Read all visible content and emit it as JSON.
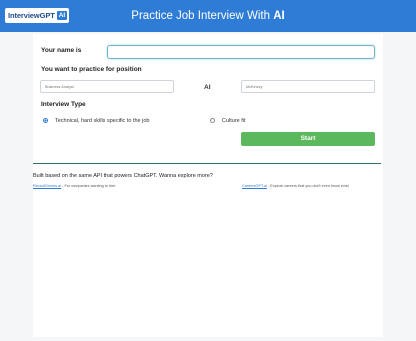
{
  "header": {
    "logo_text": "InterviewGPT",
    "logo_badge": "AI",
    "title_prefix": "Practice Job Interview With ",
    "title_strong": "AI"
  },
  "form": {
    "name_label": "Your name is",
    "name_value": "",
    "position_label": "You want to practice for position",
    "position_value": "Business Analyst",
    "separator": "AI",
    "ai_value": "McKinsey",
    "interview_type_label": "Interview Type",
    "options": [
      {
        "label": "Technical, hard skills specific to the job",
        "selected": true
      },
      {
        "label": "Culture fit",
        "selected": false
      }
    ],
    "start_label": "Start"
  },
  "footer": {
    "built_text": "Built based on the same API that powers ChatGPT. Wanna explore more?",
    "left_link": "RecruitGenius.ai",
    "left_text": " - For companies wanting to hire",
    "right_link": "CareersGPT.ai",
    "right_text": " - Explore careers that you don't even know exist"
  },
  "colors": {
    "header_bg": "#2e7cd6",
    "start_button": "#5cb85c",
    "divider": "#3a6b6e"
  }
}
